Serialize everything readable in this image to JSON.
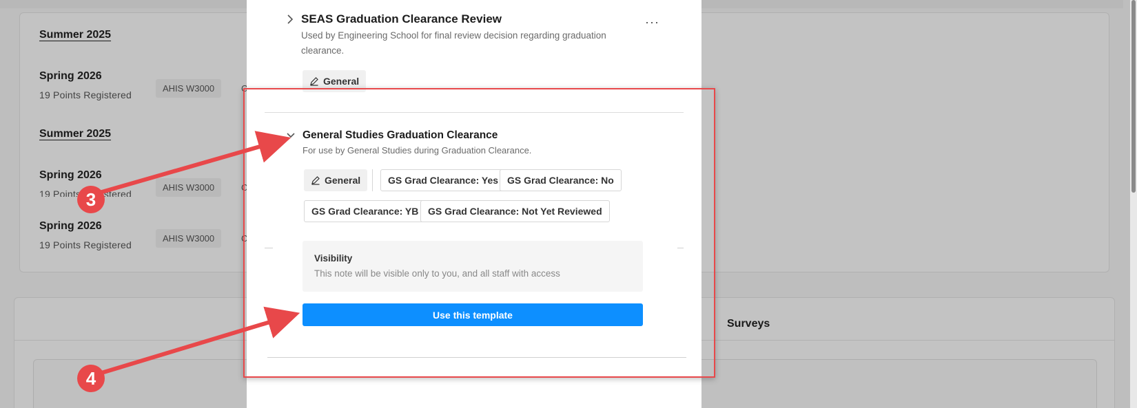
{
  "background": {
    "terms": [
      {
        "heading": "Summer 2025"
      },
      {
        "name": "Spring 2026",
        "points": "19 Points Registered",
        "course": "AHIS W3000",
        "course_trunc": "C"
      },
      {
        "heading": "Summer 2025"
      },
      {
        "name": "Spring 2026",
        "points": "19 Points Registered",
        "course": "AHIS W3000",
        "course_trunc": "C"
      },
      {
        "name": "Spring 2026",
        "points": "19 Points Registered",
        "course": "AHIS W3000",
        "course_trunc": "C"
      }
    ],
    "surveys_tab": "Surveys"
  },
  "modal": {
    "seas": {
      "title": "SEAS Graduation Clearance Review",
      "description": "Used by Engineering School for final review decision regarding graduation clearance.",
      "tag": "General",
      "more": "···"
    },
    "gs": {
      "title": "General Studies Graduation Clearance",
      "description": "For use by General Studies during Graduation Clearance.",
      "tags": [
        "General",
        "GS Grad Clearance: Yes",
        "GS Grad Clearance: No",
        "GS Grad Clearance: YB",
        "GS Grad Clearance: Not Yet Reviewed"
      ]
    },
    "visibility": {
      "title": "Visibility",
      "description": "This note will be visible only to you, and all staff with access"
    },
    "use_button": "Use this template"
  },
  "annotations": {
    "step3": "3",
    "step4": "4",
    "color": "#e8484a"
  }
}
